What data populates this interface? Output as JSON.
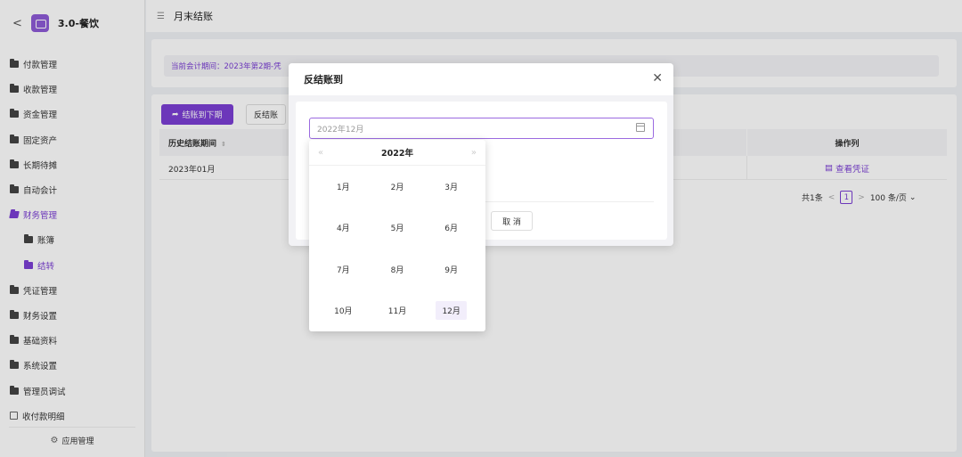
{
  "app": {
    "title": "3.0-餐饮"
  },
  "sidebar": {
    "items": [
      {
        "label": "付款管理"
      },
      {
        "label": "收款管理"
      },
      {
        "label": "资金管理"
      },
      {
        "label": "固定资产"
      },
      {
        "label": "长期待摊"
      },
      {
        "label": "自动会计"
      },
      {
        "label": "财务管理"
      },
      {
        "label": "账簿"
      },
      {
        "label": "结转"
      },
      {
        "label": "凭证管理"
      },
      {
        "label": "财务设置"
      },
      {
        "label": "基础资料"
      },
      {
        "label": "系统设置"
      },
      {
        "label": "管理员调试"
      },
      {
        "label": "收付款明细"
      }
    ],
    "footer": "应用管理"
  },
  "header": {
    "title": "月末结账"
  },
  "info": {
    "text": "当前会计期间：2023年第2期-凭"
  },
  "toolbar": {
    "primary_label": "结账到下期",
    "secondary_label": "反结账"
  },
  "table": {
    "columns": {
      "period": "历史结账期间",
      "ops": "操作列"
    },
    "rows": [
      {
        "period": "2023年01月",
        "action": "查看凭证"
      }
    ]
  },
  "pagination": {
    "total": "共1条",
    "current": "1",
    "size": "100 条/页"
  },
  "modal": {
    "title": "反结账到",
    "date_value": "2022年12月",
    "cancel_label": "取 消"
  },
  "picker": {
    "year": "2022年",
    "months": [
      "1月",
      "2月",
      "3月",
      "4月",
      "5月",
      "6月",
      "7月",
      "8月",
      "9月",
      "10月",
      "11月",
      "12月"
    ],
    "selected": "12月"
  },
  "colors": {
    "accent": "#7b3fd4"
  }
}
